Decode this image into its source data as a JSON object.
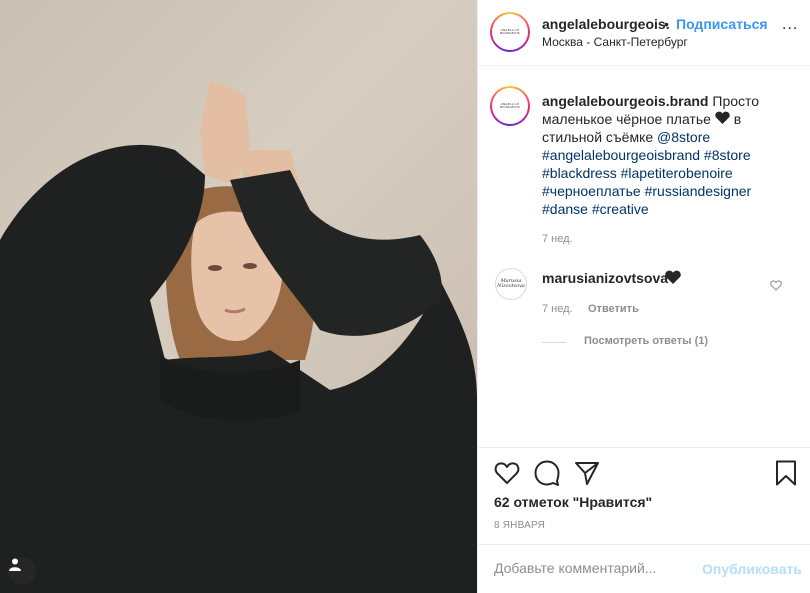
{
  "post": {
    "header": {
      "username": "angelalebourgeois.",
      "dot": "•",
      "follow_label": "Подписаться",
      "location": "Москва - Санкт-Петербург",
      "more_label": "..."
    },
    "avatar_text": "ANGELA LE BOURGEOIS",
    "caption": {
      "username": "angelalebourgeois.brand",
      "text_1": "Просто маленькое чёрное платье",
      "heart_color": "#262626",
      "text_2": "в стильной съёмке",
      "mention": "@8store",
      "hashtags": [
        "#angelalebourgeoisbrand",
        "#8store",
        "#blackdress",
        "#lapetiterobenoire",
        "#черноеплатье",
        "#russiandesigner",
        "#danse",
        "#creative"
      ],
      "time": "7 нед."
    },
    "comments": [
      {
        "avatar_text": "Marusia Nizovtsova",
        "username": "marusianizovtsova",
        "time": "7 нед.",
        "reply_label": "Ответить",
        "view_replies": "Посмотреть ответы (1)"
      }
    ],
    "likes": "62 отметок \"Нравится\"",
    "date": "8 ЯНВАРЯ",
    "comment_input": {
      "placeholder": "Добавьте комментарий...",
      "post_label": "Опубликовать"
    }
  },
  "icons": [
    "heart-icon",
    "comment-icon",
    "share-icon",
    "bookmark-icon",
    "user-tag-icon",
    "more-icon"
  ],
  "colors": {
    "link": "#003569",
    "follow": "#3897f0",
    "post_disabled": "#b2dffc",
    "secondary_text": "#8e8e8e"
  }
}
